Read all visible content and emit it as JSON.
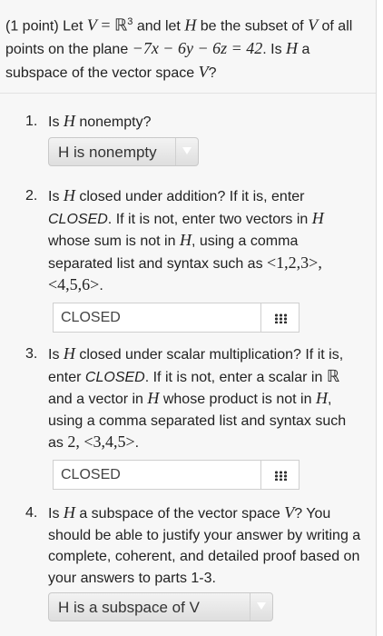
{
  "intro": {
    "prefix": "(1 point) Let ",
    "V": "V",
    "eq": " = ",
    "R": "ℝ",
    "sup3": "3",
    "and_let": " and let ",
    "H": "H",
    "be_subset": " be the subset of ",
    "V2": "V",
    "of_all": " of all points on the plane ",
    "plane_eq": "−7x − 6y − 6z = 42",
    "is_q": ". Is ",
    "H2": "H",
    "a_subspace": " a subspace of the vector space ",
    "V3": "V",
    "qmark": "?"
  },
  "questions": [
    {
      "num": "1.",
      "t1": "Is ",
      "H": "H",
      "t2": " nonempty?",
      "select_value": "H is nonempty"
    },
    {
      "num": "2.",
      "t1": "Is ",
      "H": "H",
      "t2": " closed under addition? If it is, enter ",
      "closed": "CLOSED",
      "t3": ". If it is not, enter two vectors in ",
      "H2": "H",
      "t4": " whose sum is not in ",
      "H3": "H",
      "t5": ", using a comma separated list and syntax such as ",
      "example": "<1,2,3>, <4,5,6>",
      "t6": ".",
      "input_value": "CLOSED"
    },
    {
      "num": "3.",
      "t1": "Is ",
      "H": "H",
      "t2": " closed under scalar multiplication? If it is, enter ",
      "closed": "CLOSED",
      "t3": ". If it is not, enter a scalar in ",
      "R": "ℝ",
      "t4": " and a vector in ",
      "H2": "H",
      "t5": " whose product is not in ",
      "H3": "H",
      "t6": ", using a comma separated list and syntax such as ",
      "example": "2, <3,4,5>",
      "t7": ".",
      "input_value": "CLOSED"
    },
    {
      "num": "4.",
      "t1": "Is ",
      "H": "H",
      "t2": " a subspace of the vector space ",
      "V": "V",
      "t3": "? You should be able to justify your answer by writing a complete, coherent, and detailed proof based on your answers to parts 1-3.",
      "select_value": "H is a subspace of V"
    }
  ]
}
